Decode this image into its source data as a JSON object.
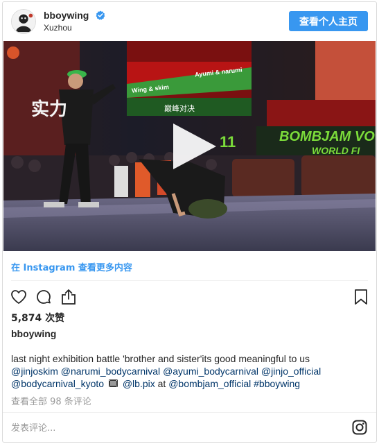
{
  "header": {
    "username": "bboywing",
    "verified": true,
    "location": "Xuzhou",
    "profile_button": "查看个人主页"
  },
  "media": {
    "type": "video",
    "banner_left": "Wing & skim",
    "banner_right": "Ayumi & narumi",
    "banner_title": "巅峰对决",
    "stage_sign": "BOMBJAM VO",
    "stage_sign_2": "WORLD FI",
    "left_sign": "实力",
    "stage_number": "11"
  },
  "view_more": "在 Instagram 查看更多内容",
  "actions": {
    "like_icon": "heart-icon",
    "comment_icon": "comment-icon",
    "share_icon": "share-icon",
    "save_icon": "bookmark-icon"
  },
  "likes": "5,874 次赞",
  "author": "bboywing",
  "caption": {
    "line1": "last night exhibition battle 'brother and sister'its good meaningful to us",
    "line2": {
      "m1": "@jinjoskim",
      "m2": "@narumi_bodycarnival",
      "m3": "@ayumi_bodycarnival",
      "m4": "@jinjo_official"
    },
    "line3": {
      "m1": "@bodycarnival_kyoto",
      "m2": "@lb.pix",
      "at": "at",
      "m3": "@bombjam_official",
      "tag": "#bboywing"
    }
  },
  "comments_link": "查看全部 98 条评论",
  "comment_placeholder": "发表评论...",
  "colors": {
    "accent": "#3897f0",
    "mention": "#003569",
    "muted": "#999999"
  }
}
